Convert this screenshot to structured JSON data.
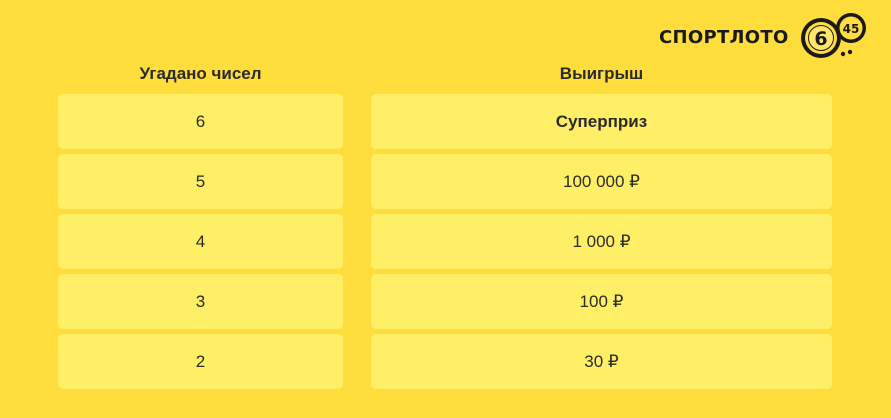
{
  "logo": {
    "text": "СПОРТЛОТО",
    "ball_big": "6",
    "ball_small": "45"
  },
  "table": {
    "headers": {
      "guessed": "Угадано чисел",
      "prize": "Выигрыш"
    },
    "rows": [
      {
        "guessed": "6",
        "prize": "Суперприз",
        "highlight": true
      },
      {
        "guessed": "5",
        "prize": "100 000 ₽",
        "highlight": false
      },
      {
        "guessed": "4",
        "prize": "1 000 ₽",
        "highlight": false
      },
      {
        "guessed": "3",
        "prize": "100 ₽",
        "highlight": false
      },
      {
        "guessed": "2",
        "prize": "30 ₽",
        "highlight": false
      }
    ]
  },
  "colors": {
    "background": "#FFDD3C",
    "cell": "#FFEF66",
    "text": "#2b2b2b",
    "logo_dark": "#1a1a1a"
  }
}
